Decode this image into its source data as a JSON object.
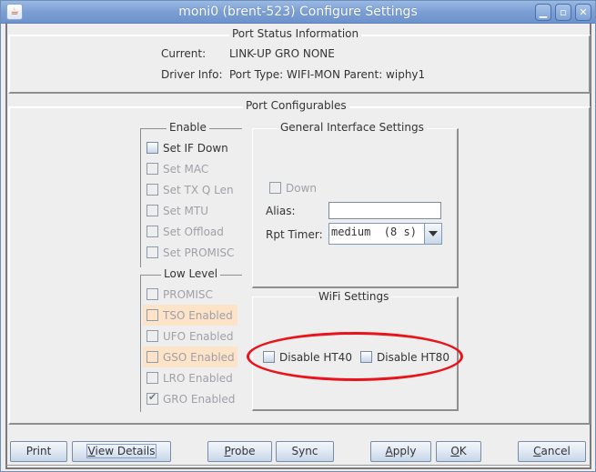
{
  "window": {
    "title": "moni0  (brent-523) Configure Settings",
    "controls": {
      "minimize": "minimize-icon",
      "maximize": "maximize-icon",
      "close": "close-icon"
    },
    "app_icon": "java-icon"
  },
  "port_status": {
    "title": "Port Status Information",
    "current_label": "Current:",
    "current_value": "LINK-UP GRO  NONE",
    "driver_label": "Driver Info:",
    "driver_value": "Port Type: WIFI-MON   Parent: wiphy1"
  },
  "port_configurables": {
    "title": "Port Configurables",
    "enable": {
      "title": "Enable",
      "items": [
        {
          "label": "Set IF Down",
          "checked": false,
          "enabled": true
        },
        {
          "label": "Set MAC",
          "checked": false,
          "enabled": false
        },
        {
          "label": "Set TX Q Len",
          "checked": false,
          "enabled": false
        },
        {
          "label": "Set MTU",
          "checked": false,
          "enabled": false
        },
        {
          "label": "Set Offload",
          "checked": false,
          "enabled": false
        },
        {
          "label": "Set PROMISC",
          "checked": false,
          "enabled": false
        }
      ]
    },
    "low_level": {
      "title": "Low Level",
      "items": [
        {
          "label": "PROMISC",
          "checked": false,
          "enabled": false,
          "highlighted": false
        },
        {
          "label": "TSO Enabled",
          "checked": false,
          "enabled": false,
          "highlighted": true
        },
        {
          "label": "UFO Enabled",
          "checked": false,
          "enabled": false,
          "highlighted": false
        },
        {
          "label": "GSO Enabled",
          "checked": false,
          "enabled": false,
          "highlighted": true
        },
        {
          "label": "LRO Enabled",
          "checked": false,
          "enabled": false,
          "highlighted": false
        },
        {
          "label": "GRO Enabled",
          "checked": true,
          "enabled": false,
          "highlighted": false
        }
      ]
    },
    "general": {
      "title": "General Interface Settings",
      "down_label": "Down",
      "down_checked": false,
      "alias_label": "Alias:",
      "alias_value": "",
      "rpt_timer_label": "Rpt Timer:",
      "rpt_timer_value": "medium  (8 s)"
    },
    "wifi": {
      "title": "WiFi Settings",
      "disable_ht40_label": "Disable HT40",
      "disable_ht40_checked": false,
      "disable_ht80_label": "Disable HT80",
      "disable_ht80_checked": false
    }
  },
  "buttons": {
    "print": "Print",
    "view_details": {
      "mnemonic": "V",
      "rest": "iew Details"
    },
    "probe": {
      "mnemonic": "P",
      "rest": "robe"
    },
    "sync": "Sync",
    "apply": {
      "mnemonic": "A",
      "rest": "pply"
    },
    "ok": {
      "mnemonic": "O",
      "rest": "K"
    },
    "cancel": {
      "mnemonic": "C",
      "rest": "ancel"
    }
  },
  "colors": {
    "titlebar": "#7b9fd4",
    "highlight_row": "#fde3c8",
    "annotation_ellipse": "#e8141a"
  }
}
